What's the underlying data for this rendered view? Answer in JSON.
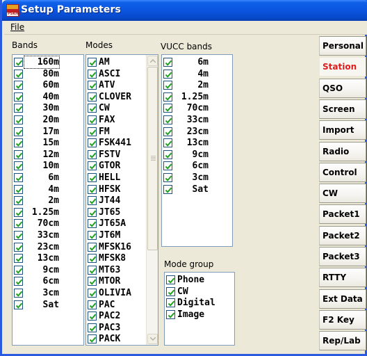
{
  "window": {
    "title": "Setup Parameters",
    "icon_text": "PSKHD"
  },
  "menu": {
    "file": "File"
  },
  "bands": {
    "label": "Bands",
    "items": [
      "160m",
      "80m",
      "60m",
      "40m",
      "30m",
      "20m",
      "17m",
      "15m",
      "12m",
      "10m",
      "6m",
      "4m",
      "2m",
      "1.25m",
      "70cm",
      "33cm",
      "23cm",
      "13cm",
      "9cm",
      "6cm",
      "3cm",
      "Sat"
    ]
  },
  "modes": {
    "label": "Modes",
    "items": [
      "AM",
      "ASCI",
      "ATV",
      "CLOVER",
      "CW",
      "FAX",
      "FM",
      "FSK441",
      "FSTV",
      "GTOR",
      "HELL",
      "HFSK",
      "JT44",
      "JT65",
      "JT65A",
      "JT6M",
      "MFSK16",
      "MFSK8",
      "MT63",
      "MTOR",
      "OLIVIA",
      "PAC",
      "PAC2",
      "PAC3",
      "PACK"
    ]
  },
  "vucc": {
    "label": "VUCC bands",
    "items": [
      "6m",
      "4m",
      "2m",
      "1.25m",
      "70cm",
      "33cm",
      "23cm",
      "13cm",
      "9cm",
      "6cm",
      "3cm",
      "Sat"
    ]
  },
  "mode_group": {
    "label": "Mode group",
    "items": [
      "Phone",
      "CW",
      "Digital",
      "Image"
    ]
  },
  "tabs": [
    "Personal",
    "Station",
    "QSO",
    "Screen",
    "Import",
    "Radio",
    "Control",
    "CW",
    "Packet1",
    "Packet2",
    "Packet3",
    "RTTY",
    "Ext Data",
    "F2 Key",
    "Rep/Lab"
  ],
  "active_tab": "Station",
  "colors": {
    "active_tab_text": "#e01c1c",
    "titlebar": "#0a55df"
  }
}
